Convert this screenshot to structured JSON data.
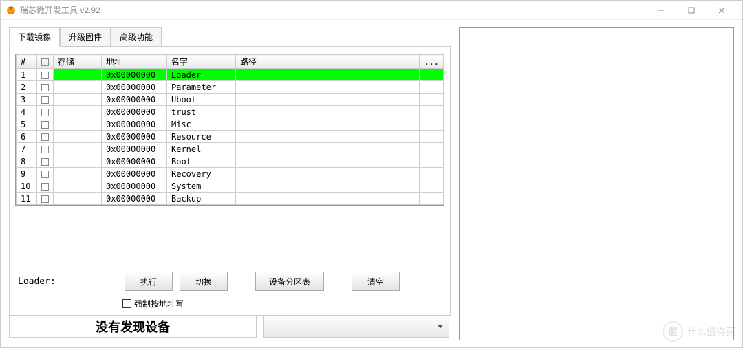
{
  "window": {
    "title": "瑞芯微开发工具 v2.92"
  },
  "tabs": [
    {
      "label": "下载镜像",
      "active": true
    },
    {
      "label": "升级固件",
      "active": false
    },
    {
      "label": "高级功能",
      "active": false
    }
  ],
  "table": {
    "headers": {
      "num": "#",
      "storage": "存储",
      "addr": "地址",
      "name": "名字",
      "path": "路径",
      "dots": "..."
    },
    "rows": [
      {
        "n": "1",
        "addr": "0x00000000",
        "name": "Loader",
        "hl": true
      },
      {
        "n": "2",
        "addr": "0x00000000",
        "name": "Parameter",
        "hl": false
      },
      {
        "n": "3",
        "addr": "0x00000000",
        "name": "Uboot",
        "hl": false
      },
      {
        "n": "4",
        "addr": "0x00000000",
        "name": "trust",
        "hl": false
      },
      {
        "n": "5",
        "addr": "0x00000000",
        "name": "Misc",
        "hl": false
      },
      {
        "n": "6",
        "addr": "0x00000000",
        "name": "Resource",
        "hl": false
      },
      {
        "n": "7",
        "addr": "0x00000000",
        "name": "Kernel",
        "hl": false
      },
      {
        "n": "8",
        "addr": "0x00000000",
        "name": "Boot",
        "hl": false
      },
      {
        "n": "9",
        "addr": "0x00000000",
        "name": "Recovery",
        "hl": false
      },
      {
        "n": "10",
        "addr": "0x00000000",
        "name": "System",
        "hl": false
      },
      {
        "n": "11",
        "addr": "0x00000000",
        "name": "Backup",
        "hl": false
      }
    ]
  },
  "loader_label": "Loader:",
  "buttons": {
    "execute": "执行",
    "switch": "切换",
    "partition_table": "设备分区表",
    "clear": "清空"
  },
  "force_write_label": "强制按地址写",
  "status": {
    "no_device": "没有发现设备"
  },
  "watermark": {
    "icon": "值",
    "text": "什么值得买"
  }
}
